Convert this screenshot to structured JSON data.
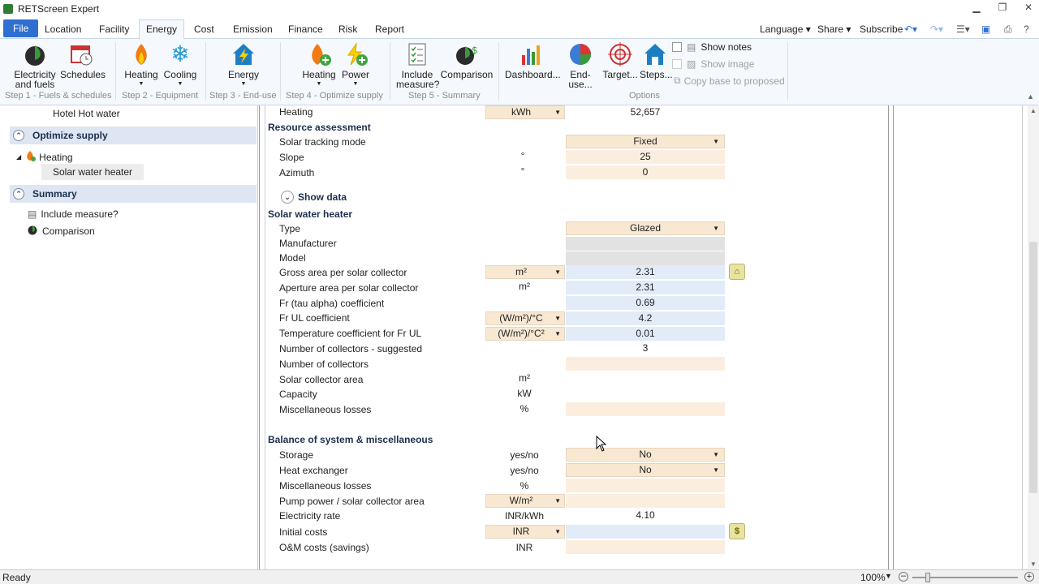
{
  "window": {
    "title": "RETScreen Expert"
  },
  "menu": {
    "items": [
      "File",
      "Location",
      "Facility",
      "Energy",
      "Cost",
      "Emission",
      "Finance",
      "Risk",
      "Report"
    ],
    "right": {
      "language": "Language",
      "share": "Share",
      "subscribe": "Subscribe"
    }
  },
  "ribbon": {
    "buttons": {
      "electricity": "Electricity and fuels",
      "schedules": "Schedules",
      "heating": "Heating",
      "cooling": "Cooling",
      "energy": "Energy",
      "heating2": "Heating",
      "power": "Power",
      "include": "Include measure?",
      "comparison": "Comparison",
      "dashboard": "Dashboard...",
      "enduse": "End-use...",
      "target": "Target...",
      "steps": "Steps..."
    },
    "groups": [
      "Step 1 - Fuels & schedules",
      "Step 2 - Equipment",
      "Step 3 - End-use",
      "Step 4 - Optimize supply",
      "Step 5 - Summary",
      "Options"
    ],
    "options": {
      "show_notes": "Show notes",
      "show_image": "Show image",
      "copy_base": "Copy base to proposed"
    }
  },
  "tree": {
    "hotel": "Hotel Hot water",
    "optimize": "Optimize supply",
    "heating": "Heating",
    "swh": "Solar water heater",
    "summary": "Summary",
    "include": "Include measure?",
    "comparison": "Comparison"
  },
  "form": {
    "heating": {
      "label": "Heating",
      "unit": "kWh",
      "value": "52,657"
    },
    "resource_header": "Resource assessment",
    "tracking": {
      "label": "Solar tracking mode",
      "value": "Fixed"
    },
    "slope": {
      "label": "Slope",
      "unit": "°",
      "value": "25"
    },
    "azimuth": {
      "label": "Azimuth",
      "unit": "°",
      "value": "0"
    },
    "show_data": "Show data",
    "swh_header": "Solar water heater",
    "type": {
      "label": "Type",
      "value": "Glazed"
    },
    "manufacturer": {
      "label": "Manufacturer"
    },
    "model": {
      "label": "Model"
    },
    "gross": {
      "label": "Gross area per solar collector",
      "unit": "m²",
      "value": "2.31"
    },
    "aperture": {
      "label": "Aperture area per solar collector",
      "unit": "m²",
      "value": "2.31"
    },
    "fr_tau": {
      "label": "Fr (tau alpha) coefficient",
      "value": "0.69"
    },
    "fr_ul": {
      "label": "Fr UL coefficient",
      "unit": "(W/m²)/°C",
      "value": "4.2"
    },
    "temp_coef": {
      "label": "Temperature coefficient for Fr UL",
      "unit": "(W/m²)/°C²",
      "value": "0.01"
    },
    "num_sugg": {
      "label": "Number of collectors - suggested",
      "value": "3"
    },
    "num": {
      "label": "Number of collectors"
    },
    "area": {
      "label": "Solar collector area",
      "unit": "m²"
    },
    "capacity": {
      "label": "Capacity",
      "unit": "kW"
    },
    "misc": {
      "label": "Miscellaneous losses",
      "unit": "%"
    },
    "bos_header": "Balance of system & miscellaneous",
    "storage": {
      "label": "Storage",
      "unit": "yes/no",
      "value": "No"
    },
    "hx": {
      "label": "Heat exchanger",
      "unit": "yes/no",
      "value": "No"
    },
    "misc2": {
      "label": "Miscellaneous losses",
      "unit": "%"
    },
    "pump": {
      "label": "Pump power / solar collector area",
      "unit": "W/m²"
    },
    "elec": {
      "label": "Electricity rate",
      "unit": "INR/kWh",
      "value": "4.10"
    },
    "initial": {
      "label": "Initial costs",
      "unit": "INR"
    },
    "om": {
      "label": "O&M costs (savings)",
      "unit": "INR"
    }
  },
  "status": {
    "text": "Ready",
    "zoom": "100%"
  }
}
